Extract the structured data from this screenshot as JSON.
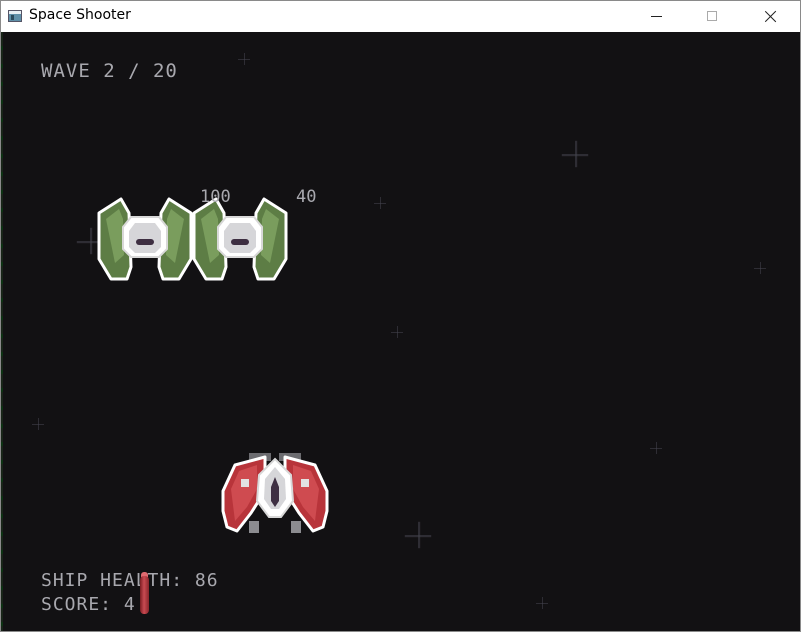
{
  "window": {
    "title": "Space Shooter",
    "controls": [
      "minimize",
      "maximize",
      "close"
    ]
  },
  "hud": {
    "wave": "WAVE 2 / 20",
    "ship_health": "SHIP HEALTH: 86",
    "score": "SCORE: 4"
  },
  "floating_labels": [
    "100",
    "40"
  ],
  "entities": {
    "enemies": [
      {
        "type": "enemy-ship",
        "color": "#6b8a4f"
      },
      {
        "type": "enemy-ship",
        "color": "#6b8a4f"
      }
    ],
    "player": {
      "type": "player-ship",
      "color": "#b8343a"
    },
    "projectile": {
      "type": "missile",
      "color": "#c1393f"
    }
  },
  "theme": {
    "background": "#121113",
    "hud_text": "#a8a8ae"
  }
}
